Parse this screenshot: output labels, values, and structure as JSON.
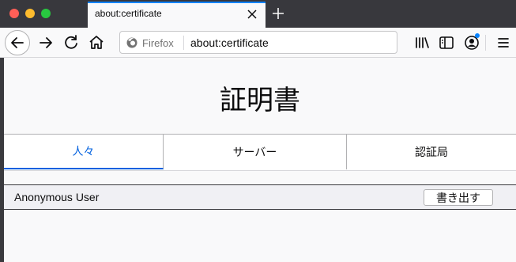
{
  "tab": {
    "title": "about:certificate"
  },
  "urlbar": {
    "identity_label": "Firefox",
    "url": "about:certificate"
  },
  "icons": {
    "back": "back-arrow-icon",
    "forward": "forward-arrow-icon",
    "reload": "reload-icon",
    "home": "home-icon",
    "library": "library-icon",
    "sidebar": "sidebar-icon",
    "account": "account-icon",
    "menu": "hamburger-menu-icon",
    "close_tab": "close-icon",
    "new_tab": "plus-icon"
  },
  "page": {
    "title": "証明書"
  },
  "cert_tabs": [
    {
      "label": "人々",
      "selected": true
    },
    {
      "label": "サーバー",
      "selected": false
    },
    {
      "label": "認証局",
      "selected": false
    }
  ],
  "certificates": [
    {
      "name": "Anonymous User",
      "export_label": "書き出す"
    }
  ],
  "colors": {
    "accent": "#0060df",
    "tab_highlight": "#0a84ff",
    "chrome_dark": "#38383d"
  }
}
